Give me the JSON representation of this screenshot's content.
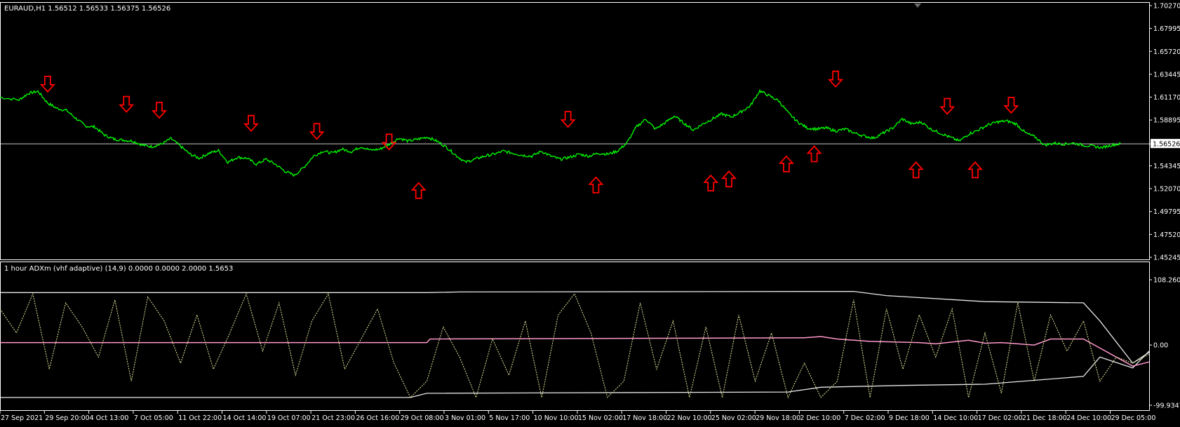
{
  "main_header": "EURAUD,H1  1.56512 1.56533 1.56375 1.56526",
  "indicator_header": "1 hour ADXm (vhf adaptive) (14,9) 0.0000 0.0000 2.0000 1.5653",
  "current_price_label": "1.56526",
  "colors": {
    "background": "#000000",
    "frame": "#ffffff",
    "price": "#00ff00",
    "arrow": "#ff0000",
    "adx_line": "#e6e6a0",
    "level_line": "#e8e8e8",
    "center_line": "#ff99cc",
    "current_price_line": "#c8c8c8"
  },
  "icons": {
    "arrow_down": "hollow-down-arrow-icon",
    "arrow_up": "hollow-up-arrow-icon",
    "scroll_marker": "triangle-down-icon"
  },
  "chart_data": [
    {
      "type": "line",
      "title": "EURAUD,H1",
      "ylim": [
        1.45245,
        1.7027
      ],
      "y_ticks": [
        "1.70270",
        "1.67995",
        "1.65720",
        "1.63445",
        "1.61170",
        "1.58895",
        "1.56526",
        "1.54345",
        "1.52070",
        "1.49795",
        "1.47520",
        "1.45245"
      ],
      "x_ticks": [
        "27 Sep 2021",
        "29 Sep 20:00",
        "4 Oct 13:00",
        "7 Oct 05:00",
        "11 Oct 22:00",
        "14 Oct 14:00",
        "19 Oct 07:00",
        "21 Oct 23:00",
        "26 Oct 16:00",
        "29 Oct 08:00",
        "3 Nov 01:00",
        "5 Nov 17:00",
        "10 Nov 10:00",
        "15 Nov 02:00",
        "17 Nov 18:00",
        "22 Nov 10:00",
        "25 Nov 02:00",
        "29 Nov 18:00",
        "2 Dec 10:00",
        "7 Dec 02:00",
        "9 Dec 18:00",
        "14 Dec 10:00",
        "17 Dec 02:00",
        "21 Dec 18:00",
        "24 Dec 10:00",
        "29 Dec 05:00"
      ],
      "current_price": 1.56526,
      "series": [
        {
          "name": "EURAUD",
          "points": [
            [
              0,
              1.6115
            ],
            [
              2,
              1.609
            ],
            [
              3,
              1.6155
            ],
            [
              4,
              1.6175
            ],
            [
              5,
              1.606
            ],
            [
              6,
              1.6005
            ],
            [
              7,
              1.5985
            ],
            [
              8,
              1.5905
            ],
            [
              9,
              1.583
            ],
            [
              10,
              1.582
            ],
            [
              11,
              1.574
            ],
            [
              12,
              1.57
            ],
            [
              13,
              1.569
            ],
            [
              14,
              1.568
            ],
            [
              15,
              1.564
            ],
            [
              16,
              1.5625
            ],
            [
              17,
              1.565
            ],
            [
              18,
              1.5705
            ],
            [
              19,
              1.563
            ],
            [
              20,
              1.555
            ],
            [
              21,
              1.551
            ],
            [
              22,
              1.556
            ],
            [
              23,
              1.5585
            ],
            [
              24,
              1.547
            ],
            [
              25,
              1.552
            ],
            [
              26,
              1.551
            ],
            [
              27,
              1.545
            ],
            [
              28,
              1.55
            ],
            [
              29,
              1.545
            ],
            [
              30,
              1.538
            ],
            [
              31,
              1.534
            ],
            [
              32,
              1.542
            ],
            [
              33,
              1.553
            ],
            [
              34,
              1.558
            ],
            [
              35,
              1.556
            ],
            [
              36,
              1.56
            ],
            [
              37,
              1.5575
            ],
            [
              38,
              1.5625
            ],
            [
              39,
              1.559
            ],
            [
              40,
              1.56
            ],
            [
              41,
              1.565
            ],
            [
              42,
              1.571
            ],
            [
              43,
              1.568
            ],
            [
              44,
              1.57
            ],
            [
              45,
              1.572
            ],
            [
              46,
              1.568
            ],
            [
              47,
              1.562
            ],
            [
              48,
              1.554
            ],
            [
              49,
              1.547
            ],
            [
              50,
              1.55
            ],
            [
              51,
              1.553
            ],
            [
              52,
              1.555
            ],
            [
              53,
              1.558
            ],
            [
              54,
              1.556
            ],
            [
              55,
              1.554
            ],
            [
              56,
              1.553
            ],
            [
              57,
              1.558
            ],
            [
              58,
              1.553
            ],
            [
              59,
              1.55
            ],
            [
              60,
              1.552
            ],
            [
              61,
              1.555
            ],
            [
              62,
              1.553
            ],
            [
              63,
              1.556
            ],
            [
              64,
              1.555
            ],
            [
              65,
              1.558
            ],
            [
              66,
              1.566
            ],
            [
              67,
              1.582
            ],
            [
              68,
              1.59
            ],
            [
              69,
              1.58
            ],
            [
              70,
              1.586
            ],
            [
              71,
              1.593
            ],
            [
              72,
              1.586
            ],
            [
              73,
              1.579
            ],
            [
              74,
              1.585
            ],
            [
              75,
              1.59
            ],
            [
              76,
              1.595
            ],
            [
              77,
              1.592
            ],
            [
              78,
              1.597
            ],
            [
              79,
              1.603
            ],
            [
              80,
              1.618
            ],
            [
              81,
              1.613
            ],
            [
              82,
              1.608
            ],
            [
              83,
              1.596
            ],
            [
              84,
              1.587
            ],
            [
              85,
              1.581
            ],
            [
              86,
              1.58
            ],
            [
              87,
              1.581
            ],
            [
              88,
              1.578
            ],
            [
              89,
              1.58
            ],
            [
              90,
              1.576
            ],
            [
              91,
              1.573
            ],
            [
              92,
              1.571
            ],
            [
              93,
              1.576
            ],
            [
              94,
              1.581
            ],
            [
              95,
              1.59
            ],
            [
              96,
              1.585
            ],
            [
              97,
              1.587
            ],
            [
              98,
              1.58
            ],
            [
              99,
              1.576
            ],
            [
              100,
              1.572
            ],
            [
              101,
              1.568
            ],
            [
              102,
              1.575
            ],
            [
              103,
              1.579
            ],
            [
              104,
              1.584
            ],
            [
              105,
              1.587
            ],
            [
              106,
              1.588
            ],
            [
              107,
              1.585
            ],
            [
              108,
              1.576
            ],
            [
              109,
              1.572
            ],
            [
              110,
              1.564
            ],
            [
              111,
              1.566
            ],
            [
              112,
              1.565
            ],
            [
              113,
              1.566
            ],
            [
              114,
              1.564
            ],
            [
              115,
              1.563
            ],
            [
              116,
              1.5615
            ],
            [
              117,
              1.564
            ],
            [
              118,
              1.5653
            ]
          ]
        }
      ],
      "signals": [
        {
          "dir": "down",
          "x": 2.9,
          "price": 1.624
        },
        {
          "dir": "down",
          "x": 7.7,
          "price": 1.604
        },
        {
          "dir": "down",
          "x": 9.7,
          "price": 1.598
        },
        {
          "dir": "down",
          "x": 15.3,
          "price": 1.585
        },
        {
          "dir": "down",
          "x": 19.3,
          "price": 1.577
        },
        {
          "dir": "down",
          "x": 23.7,
          "price": 1.5665
        },
        {
          "dir": "up",
          "x": 25.5,
          "price": 1.5195
        },
        {
          "dir": "down",
          "x": 34.6,
          "price": 1.589
        },
        {
          "dir": "up",
          "x": 36.3,
          "price": 1.525
        },
        {
          "dir": "up",
          "x": 43.3,
          "price": 1.527
        },
        {
          "dir": "up",
          "x": 44.4,
          "price": 1.531
        },
        {
          "dir": "up",
          "x": 47.9,
          "price": 1.546
        },
        {
          "dir": "up",
          "x": 49.6,
          "price": 1.556
        },
        {
          "dir": "down",
          "x": 50.9,
          "price": 1.629
        },
        {
          "dir": "up",
          "x": 55.8,
          "price": 1.54
        },
        {
          "dir": "down",
          "x": 57.7,
          "price": 1.602
        },
        {
          "dir": "up",
          "x": 59.4,
          "price": 1.54
        },
        {
          "dir": "down",
          "x": 61.6,
          "price": 1.603
        }
      ]
    },
    {
      "type": "line",
      "title": "1 hour ADXm (vhf adaptive) (14,9)",
      "ylim": [
        -99.9347,
        108.2604
      ],
      "y_ticks": [
        "108.2604",
        "0.00",
        "-99.9347"
      ],
      "series": [
        {
          "name": "upper_level",
          "points": [
            [
              0,
              87
            ],
            [
              26,
              87
            ],
            [
              28,
              88
            ],
            [
              52,
              89
            ],
            [
              54,
              82
            ],
            [
              60,
              72
            ],
            [
              66,
              70
            ],
            [
              67,
              40
            ],
            [
              69,
              -30
            ],
            [
              70,
              -12
            ]
          ]
        },
        {
          "name": "lower_level",
          "points": [
            [
              0,
              -87
            ],
            [
              25,
              -87
            ],
            [
              26,
              -80
            ],
            [
              48,
              -78
            ],
            [
              50,
              -70
            ],
            [
              55,
              -67
            ],
            [
              60,
              -65
            ],
            [
              66,
              -52
            ],
            [
              67,
              -20
            ],
            [
              69,
              -38
            ],
            [
              70,
              -10
            ]
          ]
        },
        {
          "name": "center",
          "points": [
            [
              0,
              4
            ],
            [
              26,
              4
            ],
            [
              26.2,
              10
            ],
            [
              49,
              12
            ],
            [
              50,
              14
            ],
            [
              51,
              10
            ],
            [
              53,
              6
            ],
            [
              56,
              4
            ],
            [
              57,
              2
            ],
            [
              59,
              8
            ],
            [
              60,
              3
            ],
            [
              61,
              4
            ],
            [
              63,
              0
            ],
            [
              64,
              10
            ],
            [
              66,
              10
            ],
            [
              67,
              -5
            ],
            [
              69,
              -35
            ],
            [
              70,
              -28
            ]
          ]
        },
        {
          "name": "adx_m",
          "points": [
            [
              0,
              60
            ],
            [
              1,
              20
            ],
            [
              2,
              85
            ],
            [
              3,
              -40
            ],
            [
              4,
              70
            ],
            [
              5,
              30
            ],
            [
              6,
              -20
            ],
            [
              7,
              75
            ],
            [
              8,
              -60
            ],
            [
              9,
              80
            ],
            [
              10,
              40
            ],
            [
              11,
              -30
            ],
            [
              12,
              50
            ],
            [
              13,
              -40
            ],
            [
              14,
              20
            ],
            [
              15,
              85
            ],
            [
              16,
              -10
            ],
            [
              17,
              70
            ],
            [
              18,
              -50
            ],
            [
              19,
              40
            ],
            [
              20,
              85
            ],
            [
              21,
              -40
            ],
            [
              22,
              10
            ],
            [
              23,
              60
            ],
            [
              24,
              -30
            ],
            [
              25,
              -87
            ],
            [
              26,
              -60
            ],
            [
              27,
              30
            ],
            [
              28,
              -20
            ],
            [
              29,
              -87
            ],
            [
              30,
              10
            ],
            [
              31,
              -50
            ],
            [
              32,
              40
            ],
            [
              33,
              -87
            ],
            [
              34,
              50
            ],
            [
              35,
              85
            ],
            [
              36,
              20
            ],
            [
              37,
              -87
            ],
            [
              38,
              -60
            ],
            [
              39,
              70
            ],
            [
              40,
              -40
            ],
            [
              41,
              40
            ],
            [
              42,
              -87
            ],
            [
              43,
              30
            ],
            [
              44,
              -87
            ],
            [
              45,
              50
            ],
            [
              46,
              -60
            ],
            [
              47,
              20
            ],
            [
              48,
              -87
            ],
            [
              49,
              -30
            ],
            [
              50,
              -87
            ],
            [
              51,
              -60
            ],
            [
              52,
              75
            ],
            [
              53,
              -87
            ],
            [
              54,
              60
            ],
            [
              55,
              -40
            ],
            [
              56,
              50
            ],
            [
              57,
              -20
            ],
            [
              58,
              60
            ],
            [
              59,
              -87
            ],
            [
              60,
              20
            ],
            [
              61,
              -80
            ],
            [
              62,
              70
            ],
            [
              63,
              -60
            ],
            [
              64,
              50
            ],
            [
              65,
              -10
            ],
            [
              66,
              40
            ],
            [
              67,
              -60
            ],
            [
              68,
              -20
            ],
            [
              69,
              -30
            ],
            [
              70,
              -15
            ]
          ]
        }
      ]
    }
  ]
}
